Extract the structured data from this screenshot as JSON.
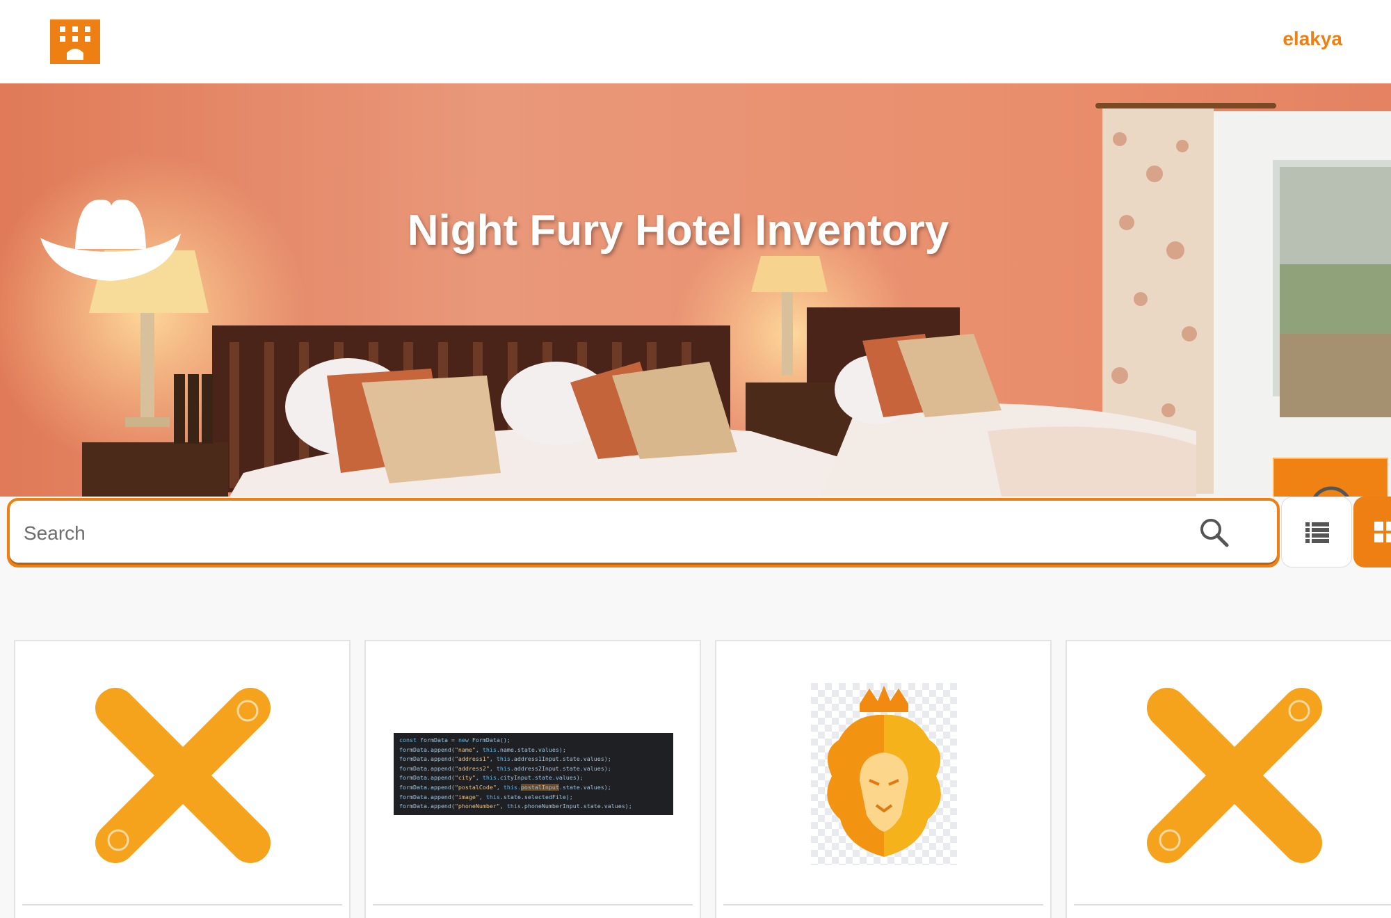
{
  "header": {
    "logo_icon": "hotel-building-icon",
    "username": "elakya"
  },
  "hero": {
    "title": "Night Fury Hotel Inventory",
    "hat_icon": "cowboy-hat-icon",
    "add_icon": "plus-circle-icon"
  },
  "search": {
    "placeholder": "Search",
    "value": "",
    "icon": "search-icon"
  },
  "view_toggle": {
    "list_icon": "list-view-icon",
    "grid_icon": "grid-view-icon",
    "active": "grid"
  },
  "hotels": [
    {
      "image": "orange-x-placeholder"
    },
    {
      "image": "code-screenshot",
      "code_lines": [
        "const formData = new FormData();",
        "formData.append(\"name\", this.name.state.values);",
        "formData.append(\"address1\", this.address1Input.state.values);",
        "formData.append(\"address2\", this.address2Input.state.values);",
        "formData.append(\"city\", this.cityInput.state.values);",
        "formData.append(\"postalCode\", this.postalInput.state.values);",
        "formData.append(\"image\", this.state.selectedFile);",
        "formData.append(\"phoneNumber\", this.phoneNumberInput.state.values);"
      ]
    },
    {
      "image": "lion-crown-logo"
    },
    {
      "image": "orange-x-placeholder"
    }
  ],
  "colors": {
    "accent": "#ee7f12",
    "hero_wall": "#e88a66",
    "x_mark": "#f5a21c"
  }
}
